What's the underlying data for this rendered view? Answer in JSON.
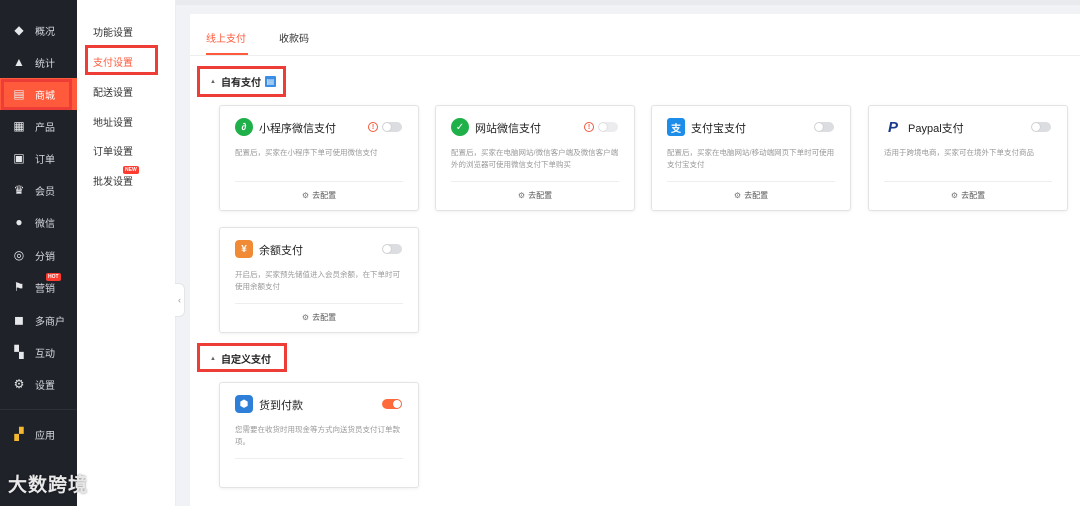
{
  "nav": {
    "items": [
      {
        "label": "概况",
        "icon": "layers-icon",
        "glyph": "◆"
      },
      {
        "label": "统计",
        "icon": "chart-icon",
        "glyph": "▲"
      },
      {
        "label": "商城",
        "icon": "shop-icon",
        "glyph": "▤"
      },
      {
        "label": "产品",
        "icon": "grid-icon",
        "glyph": "▦"
      },
      {
        "label": "订单",
        "icon": "order-icon",
        "glyph": "▣"
      },
      {
        "label": "会员",
        "icon": "crown-icon",
        "glyph": "♛"
      },
      {
        "label": "微信",
        "icon": "wechat-icon",
        "glyph": "●"
      },
      {
        "label": "分销",
        "icon": "users-icon",
        "glyph": "◎"
      },
      {
        "label": "营销",
        "icon": "flag-icon",
        "glyph": "⚑",
        "hot": "HOT"
      },
      {
        "label": "多商户",
        "icon": "merchant-icon",
        "glyph": "◼"
      },
      {
        "label": "互动",
        "icon": "interact-icon",
        "glyph": "▚"
      },
      {
        "label": "设置",
        "icon": "gear-icon",
        "glyph": "⚙"
      },
      {
        "label": "应用",
        "icon": "apps-icon",
        "glyph": "▞"
      }
    ],
    "active_index": 2
  },
  "subnav": {
    "items": [
      {
        "label": "功能设置"
      },
      {
        "label": "支付设置"
      },
      {
        "label": "配送设置"
      },
      {
        "label": "地址设置"
      },
      {
        "label": "订单设置"
      },
      {
        "label": "批发设置",
        "new": "NEW"
      }
    ],
    "active_index": 1
  },
  "tabs": [
    {
      "label": "线上支付"
    },
    {
      "label": "收款码"
    }
  ],
  "sections": {
    "own_payment": "自有支付",
    "custom_payment": "自定义支付"
  },
  "cards": {
    "mini_wechat": {
      "title": "小程序微信支付",
      "desc": "配置后，买家在小程序下单可使用微信支付",
      "config": "去配置",
      "logo_color": "#1fb04a",
      "logo_glyph": "∂",
      "toggle": "off"
    },
    "site_wechat": {
      "title": "网站微信支付",
      "desc": "配置后，买家在电脑网站/微信客户端及微信客户端外的浏览器可使用微信支付下单购买",
      "config": "去配置",
      "logo_color": "#1fb04a",
      "logo_glyph": "✓",
      "toggle": "disabled"
    },
    "alipay": {
      "title": "支付宝支付",
      "desc": "配置后，买家在电脑网站/移动端网页下单时可使用支付宝支付",
      "config": "去配置",
      "logo_color": "#1c8de8",
      "logo_glyph": "支",
      "toggle": "off"
    },
    "paypal": {
      "title": "Paypal支付",
      "desc": "适用于跨境电商，买家可在境外下单支付商品",
      "config": "去配置",
      "logo_color": "#1a3a8c",
      "logo_glyph": "P",
      "toggle": "off"
    },
    "balance": {
      "title": "余额支付",
      "desc": "开启后，买家预先储值进入会员余额，在下单时可使用余额支付",
      "config": "去配置",
      "logo_color": "#f08a35",
      "logo_glyph": "¥",
      "toggle": "off"
    },
    "cod": {
      "title": "货到付款",
      "desc": "您需要在收货时用现金等方式向送货员支付订单款项。",
      "logo_color": "#2e7fd8",
      "logo_glyph": "⬢",
      "toggle": "on"
    }
  },
  "collapse_glyph": "‹",
  "watermark": "大数跨境"
}
